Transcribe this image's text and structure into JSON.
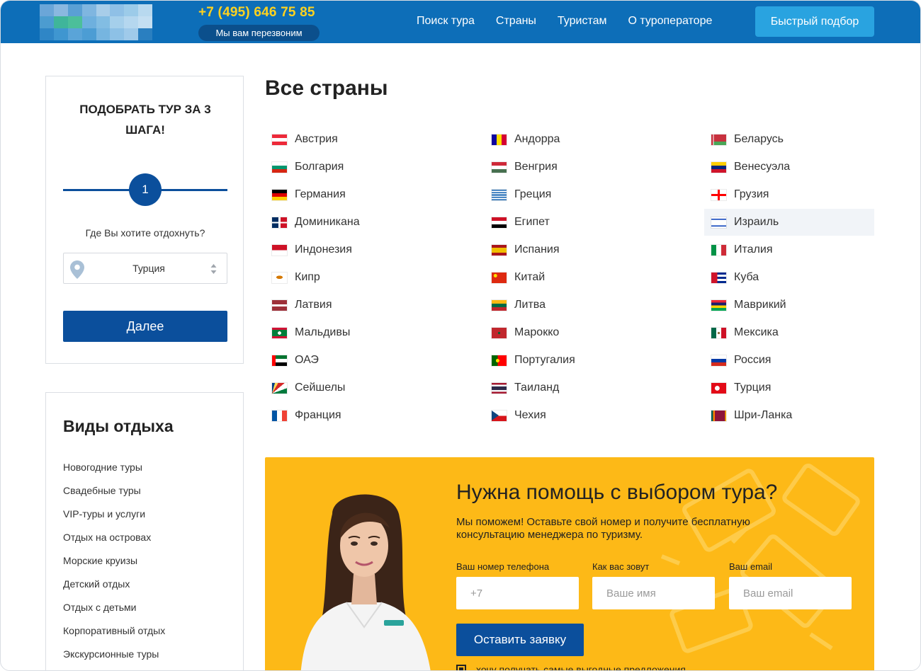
{
  "header": {
    "phone": "+7 (495) 646 75 85",
    "callback_label": "Мы вам перезвоним",
    "nav": [
      "Поиск тура",
      "Страны",
      "Туристам",
      "О туроператоре"
    ],
    "quick_pick_label": "Быстрый подбор"
  },
  "wizard": {
    "title": "ПОДОБРАТЬ ТУР ЗА 3 ШАГА!",
    "step": "1",
    "question": "Где Вы хотите отдохнуть?",
    "selected_country": "Турция",
    "next_label": "Далее"
  },
  "types": {
    "title": "Виды отдыха",
    "items": [
      "Новогодние туры",
      "Свадебные туры",
      "VIP-туры и услуги",
      "Отдых на островах",
      "Морские круизы",
      "Детский отдых",
      "Отдых с детьми",
      "Корпоративный отдых",
      "Экскурсионные туры"
    ]
  },
  "main": {
    "title": "Все страны",
    "countries": [
      {
        "name": "Австрия",
        "flag": "austria-flag-icon"
      },
      {
        "name": "Андорра",
        "flag": "andorra-flag-icon"
      },
      {
        "name": "Беларусь",
        "flag": "belarus-flag-icon"
      },
      {
        "name": "Болгария",
        "flag": "bulgaria-flag-icon"
      },
      {
        "name": "Венгрия",
        "flag": "hungary-flag-icon"
      },
      {
        "name": "Венесуэла",
        "flag": "venezuela-flag-icon"
      },
      {
        "name": "Германия",
        "flag": "germany-flag-icon"
      },
      {
        "name": "Греция",
        "flag": "greece-flag-icon"
      },
      {
        "name": "Грузия",
        "flag": "georgia-flag-icon"
      },
      {
        "name": "Доминикана",
        "flag": "dominican-flag-icon"
      },
      {
        "name": "Египет",
        "flag": "egypt-flag-icon"
      },
      {
        "name": "Израиль",
        "flag": "israel-flag-icon"
      },
      {
        "name": "Индонезия",
        "flag": "indonesia-flag-icon"
      },
      {
        "name": "Испания",
        "flag": "spain-flag-icon"
      },
      {
        "name": "Италия",
        "flag": "italy-flag-icon"
      },
      {
        "name": "Кипр",
        "flag": "cyprus-flag-icon"
      },
      {
        "name": "Китай",
        "flag": "china-flag-icon"
      },
      {
        "name": "Куба",
        "flag": "cuba-flag-icon"
      },
      {
        "name": "Латвия",
        "flag": "latvia-flag-icon"
      },
      {
        "name": "Литва",
        "flag": "lithuania-flag-icon"
      },
      {
        "name": "Маврикий",
        "flag": "mauritius-flag-icon"
      },
      {
        "name": "Мальдивы",
        "flag": "maldives-flag-icon"
      },
      {
        "name": "Марокко",
        "flag": "morocco-flag-icon"
      },
      {
        "name": "Мексика",
        "flag": "mexico-flag-icon"
      },
      {
        "name": "ОАЭ",
        "flag": "uae-flag-icon"
      },
      {
        "name": "Португалия",
        "flag": "portugal-flag-icon"
      },
      {
        "name": "Россия",
        "flag": "russia-flag-icon"
      },
      {
        "name": "Сейшелы",
        "flag": "seychelles-flag-icon"
      },
      {
        "name": "Таиланд",
        "flag": "thailand-flag-icon"
      },
      {
        "name": "Турция",
        "flag": "turkey-flag-icon"
      },
      {
        "name": "Франция",
        "flag": "france-flag-icon"
      },
      {
        "name": "Чехия",
        "flag": "czech-flag-icon"
      },
      {
        "name": "Шри-Ланка",
        "flag": "srilanka-flag-icon"
      }
    ],
    "highlighted_country": "Израиль"
  },
  "help": {
    "title": "Нужна помощь с выбором тура?",
    "subtitle": "Мы поможем! Оставьте свой номер и получите бесплатную консультацию менеджера по туризму.",
    "phone_label": "Ваш номер телефона",
    "phone_placeholder": "+7",
    "name_label": "Как вас зовут",
    "name_placeholder": "Ваше имя",
    "email_label": "Ваш email",
    "email_placeholder": "Ваш email",
    "submit_label": "Оставить заявку",
    "consent": "хочу получать самые выгодные предложения"
  },
  "colors": {
    "header_bg": "#0d6eb8",
    "accent_yellow": "#ffd21f",
    "primary_button": "#0b4f9c",
    "quick_pick_button": "#29a3e0",
    "banner_bg": "#fdb917"
  }
}
